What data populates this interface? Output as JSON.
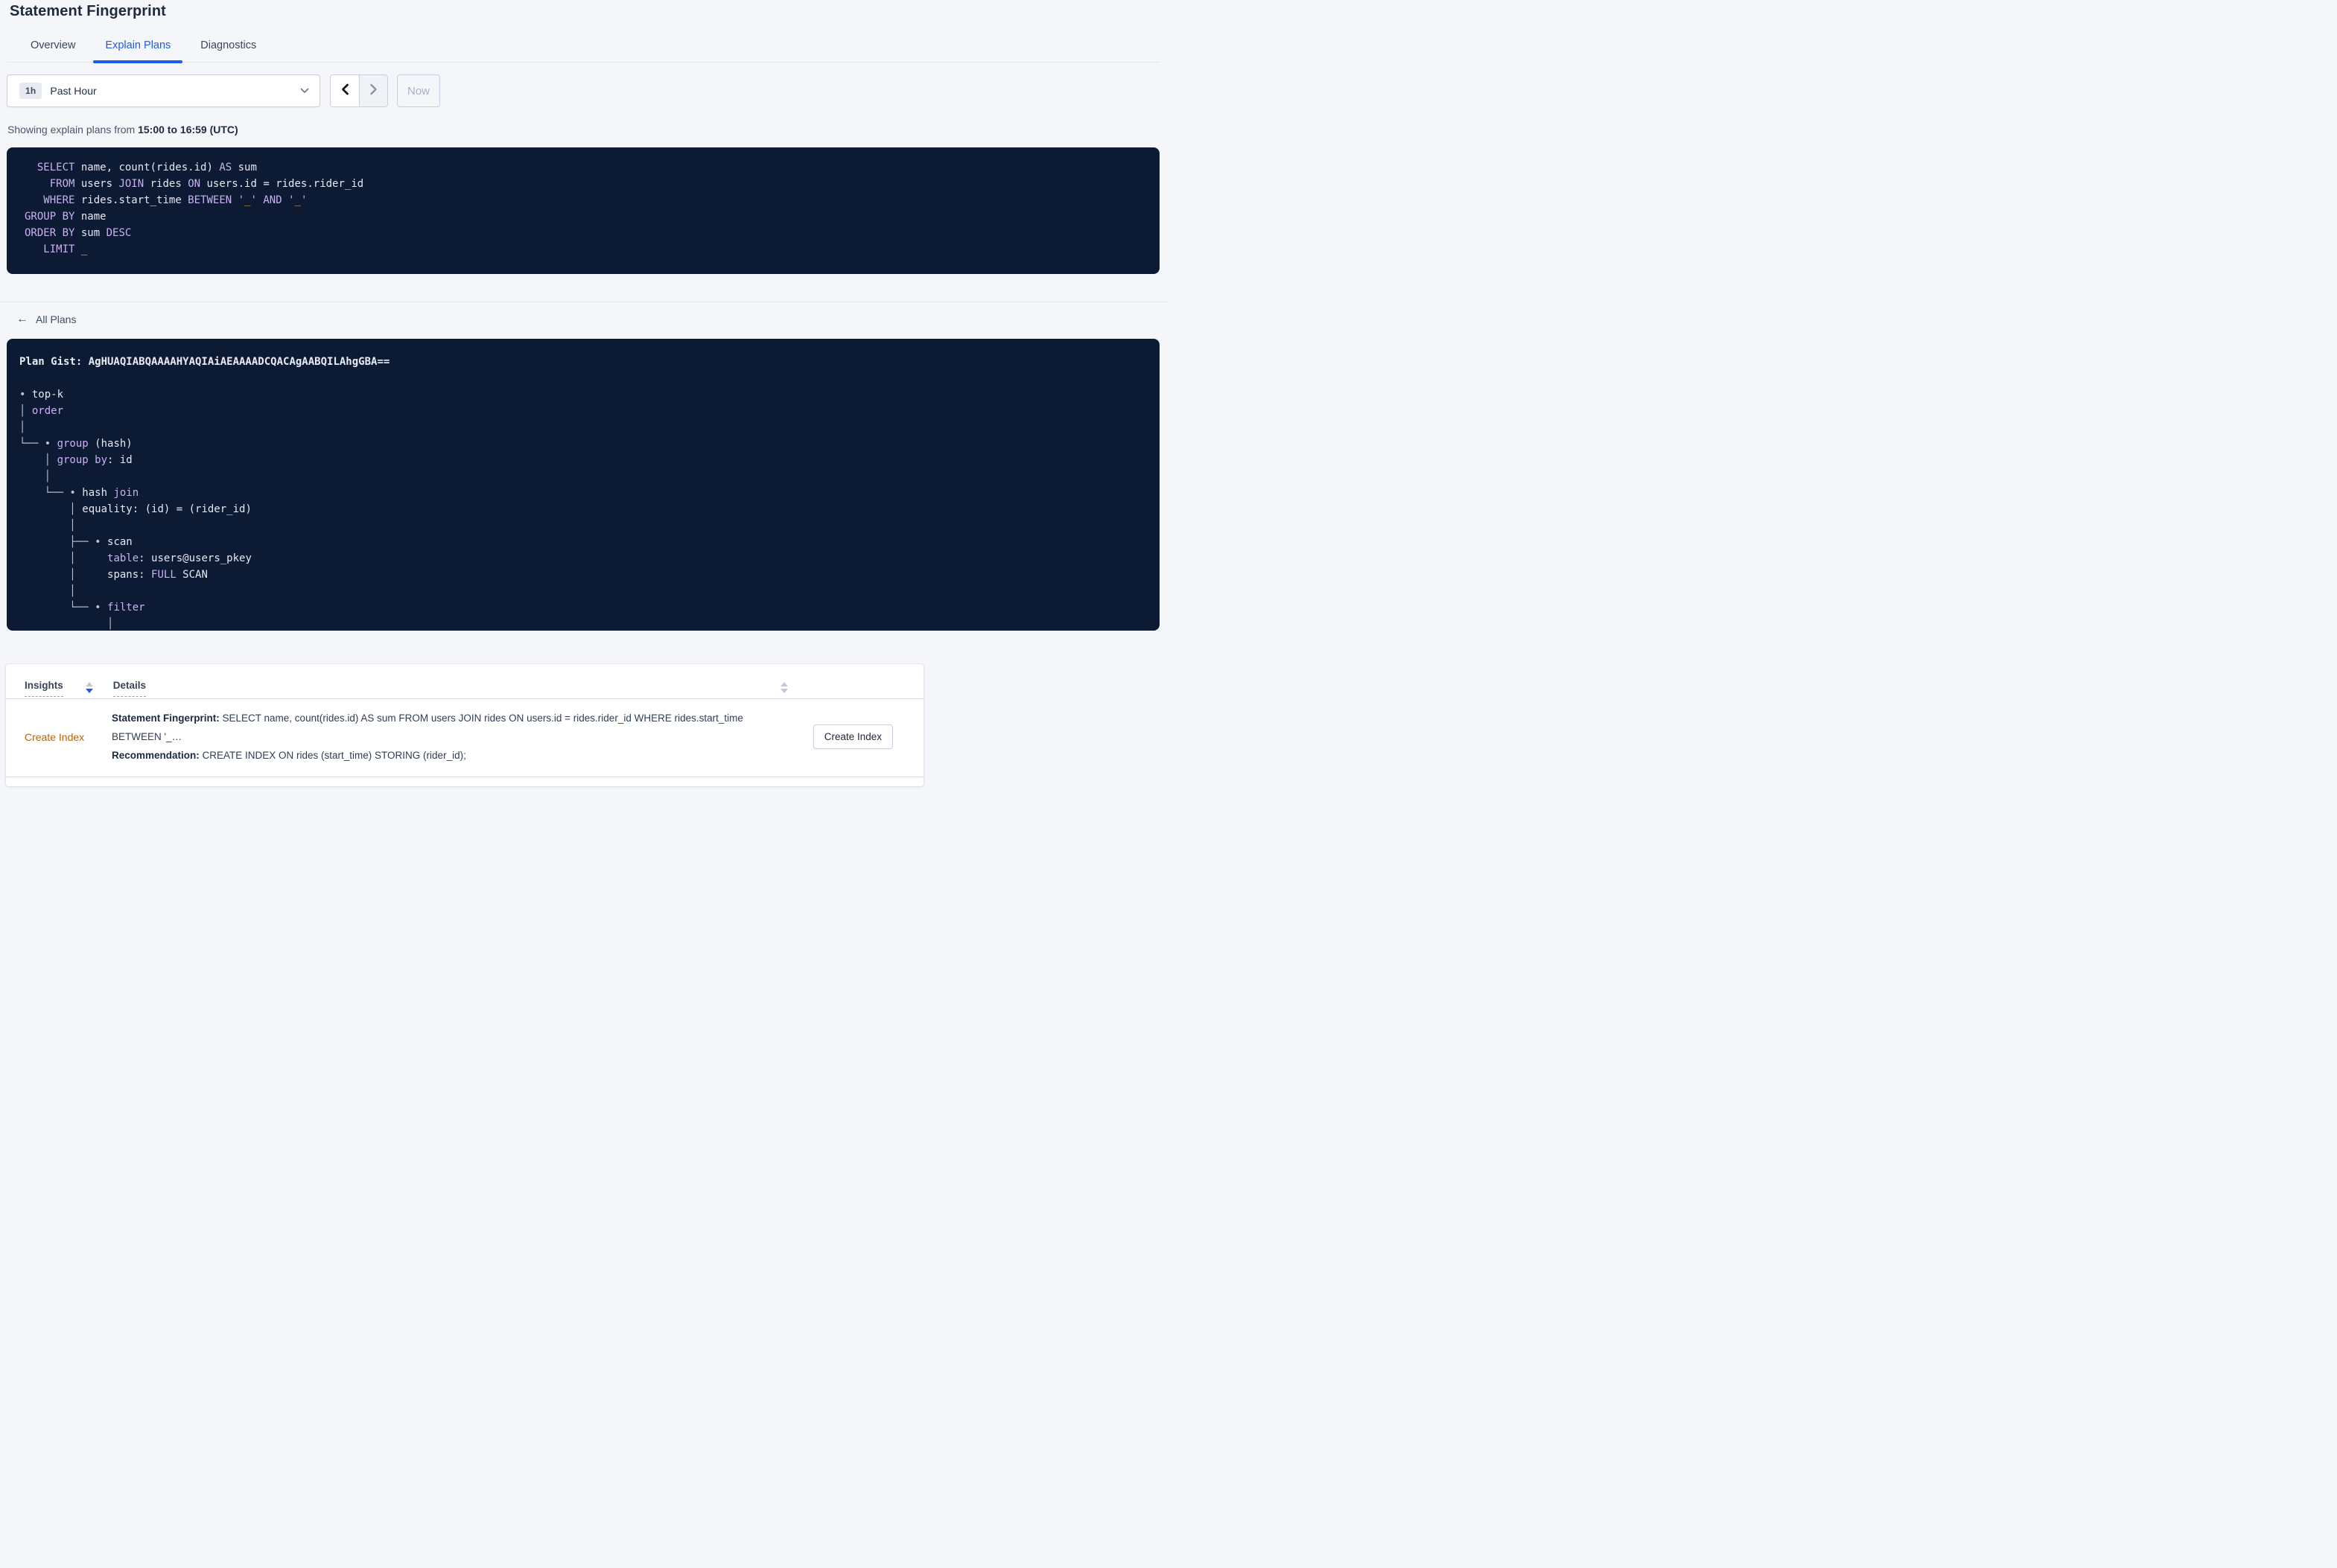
{
  "page": {
    "title": "Statement Fingerprint"
  },
  "tabs": [
    {
      "label": "Overview"
    },
    {
      "label": "Explain Plans"
    },
    {
      "label": "Diagnostics"
    }
  ],
  "time_picker": {
    "badge": "1h",
    "label": "Past Hour"
  },
  "time_nav": {
    "now_label": "Now"
  },
  "showing": {
    "prefix": "Showing explain plans from ",
    "range": "15:00 to 16:59 (UTC)"
  },
  "sql": {
    "lines": [
      [
        [
          "pl",
          "  "
        ],
        [
          "kw",
          "SELECT"
        ],
        [
          "pl",
          " name, count(rides.id) "
        ],
        [
          "kw",
          "AS"
        ],
        [
          "pl",
          " sum"
        ]
      ],
      [
        [
          "pl",
          "    "
        ],
        [
          "kw",
          "FROM"
        ],
        [
          "pl",
          " users "
        ],
        [
          "kw",
          "JOIN"
        ],
        [
          "pl",
          " rides "
        ],
        [
          "kw",
          "ON"
        ],
        [
          "pl",
          " users.id = rides.rider_id"
        ]
      ],
      [
        [
          "pl",
          "   "
        ],
        [
          "kw",
          "WHERE"
        ],
        [
          "pl",
          " rides.start_time "
        ],
        [
          "kw",
          "BETWEEN"
        ],
        [
          "pl",
          " "
        ],
        [
          "kw",
          "'"
        ],
        [
          "ph",
          "_"
        ],
        [
          "kw",
          "'"
        ],
        [
          "pl",
          " "
        ],
        [
          "kw",
          "AND"
        ],
        [
          "pl",
          " "
        ],
        [
          "kw",
          "'"
        ],
        [
          "ph",
          "_"
        ],
        [
          "kw",
          "'"
        ]
      ],
      [
        [
          "kw",
          "GROUP BY"
        ],
        [
          "pl",
          " name"
        ]
      ],
      [
        [
          "kw",
          "ORDER BY"
        ],
        [
          "pl",
          " sum "
        ],
        [
          "kw",
          "DESC"
        ]
      ],
      [
        [
          "pl",
          "   "
        ],
        [
          "kw",
          "LIMIT"
        ],
        [
          "mut",
          " _"
        ]
      ]
    ]
  },
  "all_plans": {
    "label": "All Plans"
  },
  "plan": {
    "gist_label": "Plan Gist: ",
    "gist": "AgHUAQIABQAAAAHYAQIAiAEAAAADCQACAgAABQILAhgGBA==",
    "tree_lines": [
      [
        [
          "tr",
          "• "
        ],
        [
          "pl",
          "top-k"
        ]
      ],
      [
        [
          "tr",
          "│ "
        ],
        [
          "kw",
          "order"
        ]
      ],
      [
        [
          "tr",
          "│"
        ]
      ],
      [
        [
          "tr",
          "└── • "
        ],
        [
          "kw",
          "group"
        ],
        [
          "pl",
          " (hash)"
        ]
      ],
      [
        [
          "tr",
          "    │ "
        ],
        [
          "kw",
          "group by"
        ],
        [
          "pl",
          ": id"
        ]
      ],
      [
        [
          "tr",
          "    │"
        ]
      ],
      [
        [
          "tr",
          "    └── • "
        ],
        [
          "pl",
          "hash "
        ],
        [
          "kw",
          "join"
        ]
      ],
      [
        [
          "tr",
          "        │ "
        ],
        [
          "pl",
          "equality: (id) = (rider_id)"
        ]
      ],
      [
        [
          "tr",
          "        │"
        ]
      ],
      [
        [
          "tr",
          "        ├── • "
        ],
        [
          "pl",
          "scan"
        ]
      ],
      [
        [
          "tr",
          "        │     "
        ],
        [
          "kw",
          "table"
        ],
        [
          "pl",
          ": users@users_pkey"
        ]
      ],
      [
        [
          "tr",
          "        │     "
        ],
        [
          "pl",
          "spans: "
        ],
        [
          "kw",
          "FULL"
        ],
        [
          "pl",
          " SCAN"
        ]
      ],
      [
        [
          "tr",
          "        │"
        ]
      ],
      [
        [
          "tr",
          "        └── • "
        ],
        [
          "kw",
          "filter"
        ]
      ],
      [
        [
          "tr",
          "              │"
        ]
      ]
    ]
  },
  "insights_table": {
    "columns": [
      "Insights",
      "Details"
    ],
    "row": {
      "insight": "Create Index",
      "fingerprint_label": "Statement Fingerprint:",
      "fingerprint_text": " SELECT name, count(rides.id) AS sum FROM users JOIN rides ON users.id = rides.rider_id WHERE rides.start_time BETWEEN '_…",
      "recommendation_label": "Recommendation:",
      "recommendation_text": " CREATE INDEX ON rides (start_time) STORING (rider_id);",
      "action_label": "Create Index"
    }
  },
  "colors": {
    "accent_blue": "#1f5be8",
    "code_background": "#0d1a33",
    "code_keyword": "#c9b2f2",
    "code_placeholder": "#dc9a4e",
    "insight_orange": "#b5650a"
  }
}
